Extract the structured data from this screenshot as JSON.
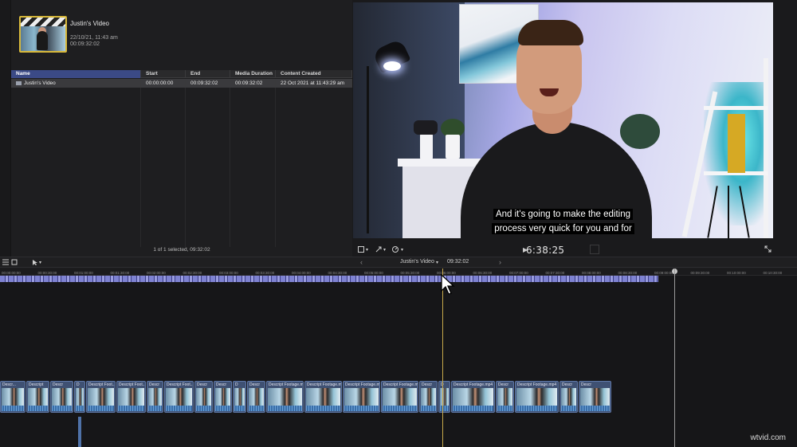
{
  "browser": {
    "clip": {
      "title": "Justin's Video",
      "date": "22/10/21, 11:43 am",
      "duration": "00:09:32:02"
    },
    "columns": [
      "Name",
      "Start",
      "End",
      "Media Duration",
      "Content Created"
    ],
    "rows": [
      {
        "name": "Justin's Video",
        "start": "00:00:00:00",
        "end": "00:09:32:02",
        "media_duration": "00:09:32:02",
        "content_created": "22 Oct 2021 at 11:43:29 am"
      }
    ],
    "status": "1 of 1 selected, 09:32:02"
  },
  "viewer": {
    "subtitles": [
      "And it's going to make the editing",
      "process very quick for you and for"
    ],
    "timecode": "6:38:25",
    "controls": [
      "transform-icon",
      "trim-icon",
      "speed-icon",
      "play-icon",
      "fullscreen-icon"
    ]
  },
  "timeline_toolbar": {
    "timeline_name": "Justin's Video",
    "timeline_duration": "09:32:02",
    "prev_icon": "‹",
    "next_icon": "›"
  },
  "timeline": {
    "ruler_ticks": [
      "00:00:00:00",
      "00:00:30:00",
      "00:01:00:00",
      "00:01:30:00",
      "00:02:00:00",
      "00:02:30:00",
      "00:03:00:00",
      "00:03:30:00",
      "00:04:00:00",
      "00:04:30:00",
      "00:05:00:00",
      "00:05:30:00",
      "00:06:00:00",
      "00:06:30:00",
      "00:07:00:00",
      "00:07:30:00",
      "00:08:00:00",
      "00:08:30:00",
      "00:09:00:00",
      "00:09:30:00",
      "00:10:00:00",
      "00:10:30:00",
      "00:11:00:00"
    ],
    "clips": [
      "Descr...",
      "Descript",
      "Descr",
      "D",
      "Descript Foot...",
      "Descript Foot...",
      "Descr",
      "Descript Foot...",
      "Descr",
      "Descr",
      "D",
      "Descr",
      "Descript Footage.mp4",
      "Descript Footage.mp4",
      "Descript Footage.mp4",
      "Descript Footage.mp4",
      "Descr",
      "D",
      "Descript Footage.mp4",
      "Descr",
      "Descript Footage.mp4",
      "Descr",
      "Descr"
    ]
  },
  "watermark": "wtvid.com",
  "colors": {
    "caption_lane": "#4a4c9a",
    "clip": "#3f5173",
    "playhead": "#c8a94a",
    "selected_header": "#3b4a86"
  }
}
